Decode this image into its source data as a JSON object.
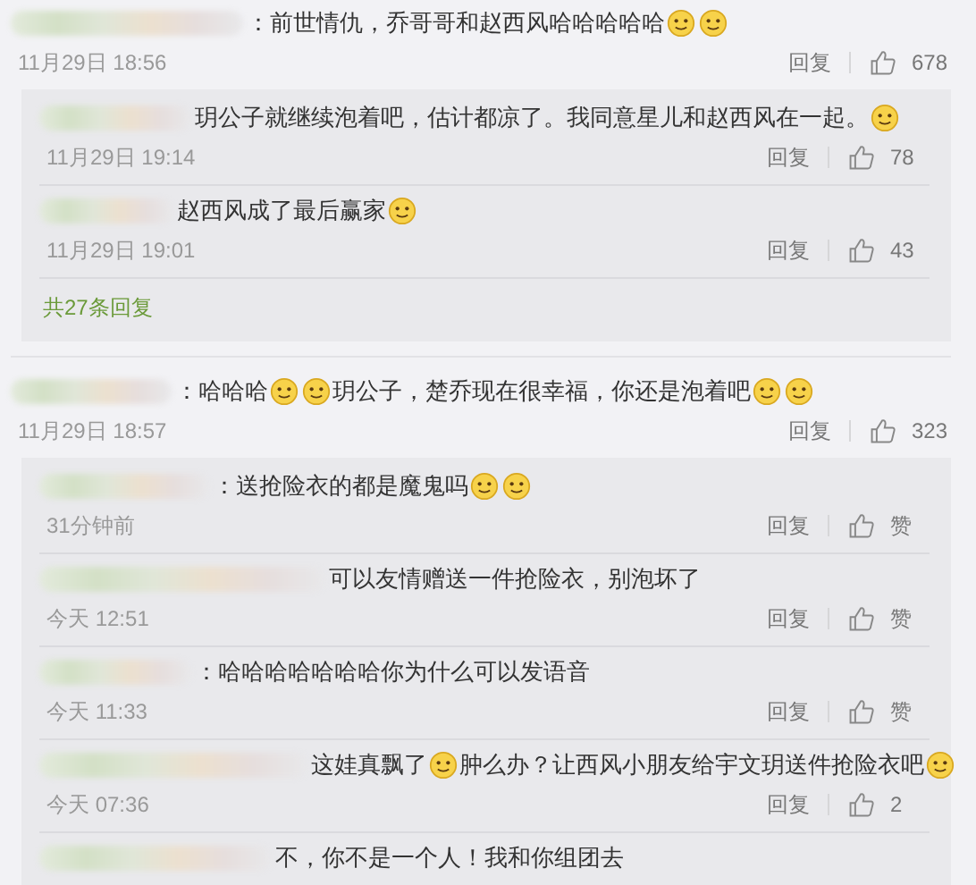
{
  "comments": [
    {
      "content": [
        {
          "kind": "text",
          "text": "：前世情仇，乔哥哥和赵西风哈哈哈哈哈"
        },
        {
          "kind": "emoji"
        },
        {
          "kind": "emoji"
        }
      ],
      "time": "11月29日 18:56",
      "reply": "回复",
      "likes": "678",
      "replies": [
        {
          "content": [
            {
              "kind": "text",
              "text": "玥公子就继续泡着吧，估计都凉了。我同意星儿和赵西风在一起。"
            },
            {
              "kind": "emoji"
            }
          ],
          "time": "11月29日 19:14",
          "reply": "回复",
          "likes": "78"
        },
        {
          "content": [
            {
              "kind": "text",
              "text": "赵西风成了最后赢家"
            },
            {
              "kind": "emoji"
            }
          ],
          "time": "11月29日 19:01",
          "reply": "回复",
          "likes": "43"
        }
      ],
      "more": "共27条回复"
    },
    {
      "content": [
        {
          "kind": "text",
          "text": "：哈哈哈"
        },
        {
          "kind": "emoji"
        },
        {
          "kind": "emoji"
        },
        {
          "kind": "text",
          "text": "玥公子，楚乔现在很幸福，你还是泡着吧"
        },
        {
          "kind": "emoji"
        },
        {
          "kind": "emoji"
        }
      ],
      "time": "11月29日 18:57",
      "reply": "回复",
      "likes": "323",
      "replies": [
        {
          "content": [
            {
              "kind": "text",
              "text": "：送抢险衣的都是魔鬼吗"
            },
            {
              "kind": "emoji"
            },
            {
              "kind": "emoji"
            }
          ],
          "time": "31分钟前",
          "reply": "回复",
          "likes": "赞"
        },
        {
          "content": [
            {
              "kind": "text",
              "text": "可以友情赠送一件抢险衣，别泡坏了"
            }
          ],
          "time": "今天 12:51",
          "reply": "回复",
          "likes": "赞"
        },
        {
          "content": [
            {
              "kind": "text",
              "text": "：哈哈哈哈哈哈哈你为什么可以发语音"
            }
          ],
          "time": "今天 11:33",
          "reply": "回复",
          "likes": "赞"
        },
        {
          "content": [
            {
              "kind": "text",
              "text": "这娃真飘了"
            },
            {
              "kind": "emoji"
            },
            {
              "kind": "text",
              "text": "肿么办？让西风小朋友给宇文玥送件抢险衣吧"
            },
            {
              "kind": "emoji"
            }
          ],
          "time": "今天 07:36",
          "reply": "回复",
          "likes": "2"
        },
        {
          "content": [
            {
              "kind": "text",
              "text": "不，你不是一个人！我和你组团去"
            }
          ]
        }
      ]
    }
  ]
}
